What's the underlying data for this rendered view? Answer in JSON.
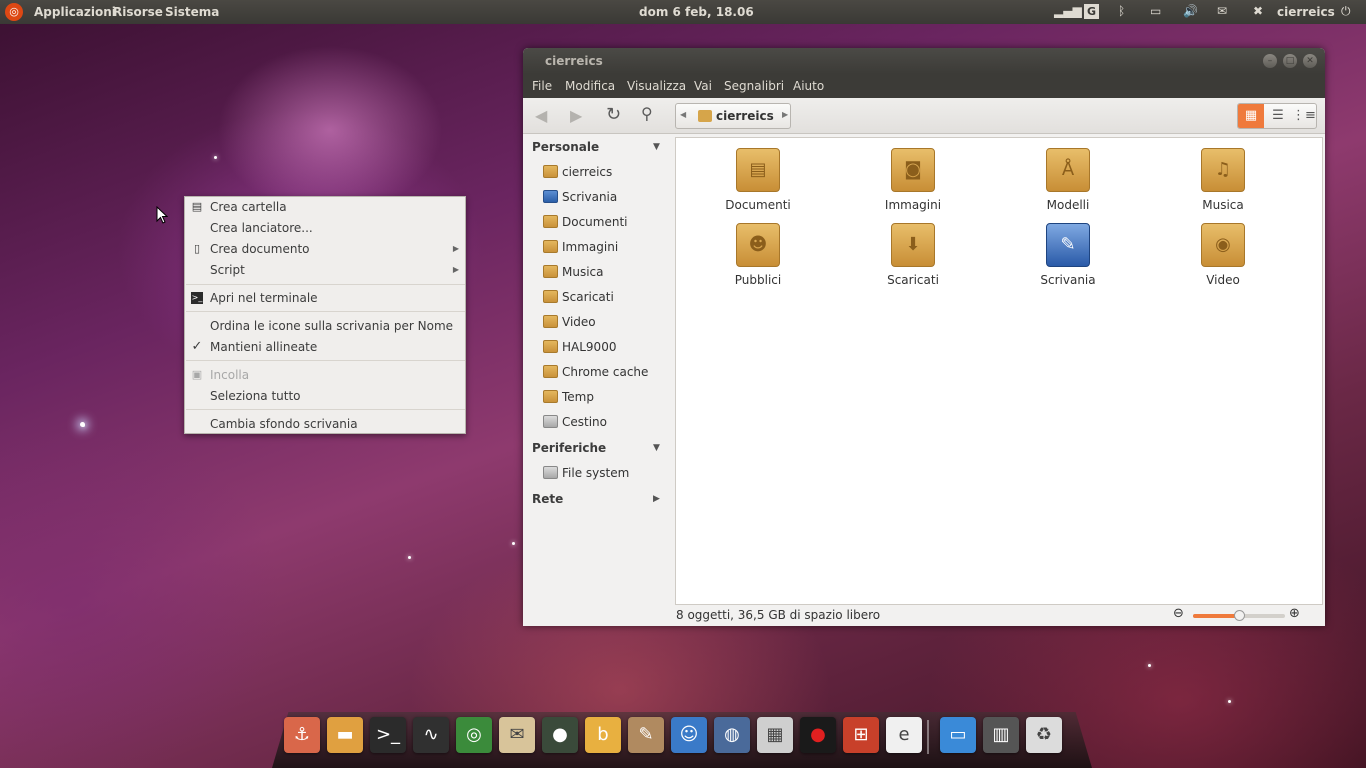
{
  "top_panel": {
    "menus": [
      "Applicazioni",
      "Risorse",
      "Sistema"
    ],
    "clock": "dom  6 feb, 18.06",
    "user": "cierreics",
    "indicator_g": "G"
  },
  "context_menu": {
    "items": [
      {
        "label": "Crea cartella",
        "icon": "folder-new-icon"
      },
      {
        "label": "Crea lanciatore..."
      },
      {
        "label": "Crea documento",
        "icon": "document-new-icon",
        "submenu": true
      },
      {
        "label": "Script",
        "submenu": true
      },
      {
        "label": "Apri nel terminale",
        "icon": "terminal-icon"
      },
      {
        "label": "Ordina le icone sulla scrivania per Nome"
      },
      {
        "label": "Mantieni allineate",
        "checked": true
      },
      {
        "label": "Incolla",
        "icon": "paste-icon",
        "disabled": true
      },
      {
        "label": "Seleziona tutto"
      },
      {
        "label": "Cambia sfondo scrivania"
      }
    ]
  },
  "file_manager": {
    "title": "cierreics",
    "menubar": [
      "File",
      "Modifica",
      "Visualizza",
      "Vai",
      "Segnalibri",
      "Aiuto"
    ],
    "path": "cierreics",
    "view_mode": "icons",
    "sidebar": {
      "personal_header": "Personale",
      "personal": [
        "cierreics",
        "Scrivania",
        "Documenti",
        "Immagini",
        "Musica",
        "Scaricati",
        "Video",
        "HAL9000",
        "Chrome cache",
        "Temp",
        "Cestino"
      ],
      "devices_header": "Periferiche",
      "devices": [
        "File system"
      ],
      "network_header": "Rete"
    },
    "files": [
      "Documenti",
      "Immagini",
      "Modelli",
      "Musica",
      "Pubblici",
      "Scaricati",
      "Scrivania",
      "Video"
    ],
    "status": "8 oggetti, 36,5 GB di spazio libero",
    "zoom_level": 0.5
  },
  "dock": {
    "apps": [
      {
        "icon": "anchor-icon",
        "color": "#d9674a"
      },
      {
        "icon": "files-icon",
        "color": "#e0a040"
      },
      {
        "icon": "terminal-icon",
        "color": "#2b2b2b"
      },
      {
        "icon": "system-monitor-icon",
        "color": "#303030"
      },
      {
        "icon": "chrome-icon",
        "color": "#3b8b3b"
      },
      {
        "icon": "mail-icon",
        "color": "#d8c49a"
      },
      {
        "icon": "camera-icon",
        "color": "#3a4a3a"
      },
      {
        "icon": "bluefish-icon",
        "color": "#e8b040"
      },
      {
        "icon": "gimp-icon",
        "color": "#b08a60"
      },
      {
        "icon": "empathy-icon",
        "color": "#3a7ac8"
      },
      {
        "icon": "globe-icon",
        "color": "#4a6a9a"
      },
      {
        "icon": "calculator-icon",
        "color": "#cfcfcf"
      },
      {
        "icon": "hal9000-icon",
        "color": "#1a1a1a"
      },
      {
        "icon": "windows-icon",
        "color": "#c8402a"
      },
      {
        "icon": "editor-icon",
        "color": "#f0f0f0"
      },
      {
        "icon": "desktop-icon",
        "color": "#3a8ad8"
      },
      {
        "icon": "workspace-switcher-icon",
        "color": "#555555"
      },
      {
        "icon": "trash-icon",
        "color": "#dcdcdc"
      }
    ]
  }
}
